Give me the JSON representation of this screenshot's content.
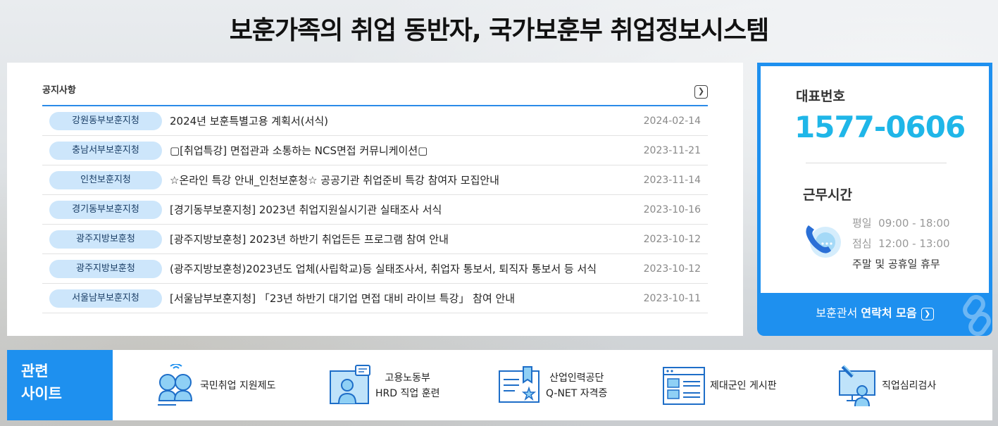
{
  "title": "보훈가족의 취업 동반자, 국가보훈부 취업정보시스템",
  "notice": {
    "heading": "공지사항",
    "more_icon": "chevron-right-icon",
    "items": [
      {
        "org": "강원동부보훈지청",
        "title": "2024년 보훈특별고용 계획서(서식)",
        "date": "2024-02-14"
      },
      {
        "org": "충남서부보훈지청",
        "title": "▢[취업특강] 면접관과 소통하는 NCS면접 커뮤니케이션▢",
        "date": "2023-11-21"
      },
      {
        "org": "인천보훈지청",
        "title": "☆온라인 특강 안내_인천보훈청☆ 공공기관 취업준비 특강 참여자 모집안내",
        "date": "2023-11-14"
      },
      {
        "org": "경기동부보훈지청",
        "title": " [경기동부보훈지청] 2023년 취업지원실시기관 실태조사 서식",
        "date": "2023-10-16"
      },
      {
        "org": "광주지방보훈청",
        "title": "[광주지방보훈청] 2023년 하반기 취업든든 프로그램 참여 안내",
        "date": "2023-10-12"
      },
      {
        "org": "광주지방보훈청",
        "title": "(광주지방보훈청)2023년도 업체(사립학교)등 실태조사서, 취업자 통보서, 퇴직자 통보서 등 서식",
        "date": "2023-10-12"
      },
      {
        "org": "서울남부보훈지청",
        "title": "[서울남부보훈지청] 「23년 하반기 대기업 면접 대비 라이브 특강」 참여 안내",
        "date": "2023-10-11"
      }
    ]
  },
  "contact": {
    "rep_label": "대표번호",
    "rep_number": "1577-0606",
    "hours_label": "근무시간",
    "hours": [
      {
        "label": "평일",
        "value": "09:00 - 18:00"
      },
      {
        "label": "점심",
        "value": "12:00 - 13:00"
      },
      {
        "label": "",
        "value": "주말 및 공휴일 휴무"
      }
    ],
    "link_prefix": "보훈관서 ",
    "link_bold": "연락처 모음",
    "accent": "#1e90ef",
    "number_color": "#1fb6e8"
  },
  "related": {
    "label_line1": "관련",
    "label_line2": "사이트",
    "sites": [
      {
        "line1": "국민취업 지원제도",
        "line2": "",
        "icon": "people-icon"
      },
      {
        "line1": "고용노동부",
        "line2": "HRD 직업 훈련",
        "icon": "teacher-icon"
      },
      {
        "line1": "산업인력공단",
        "line2": "Q-NET 자격증",
        "icon": "certificate-icon"
      },
      {
        "line1": "제대군인 게시판",
        "line2": "",
        "icon": "board-icon"
      },
      {
        "line1": "직업심리검사",
        "line2": "",
        "icon": "test-icon"
      }
    ]
  }
}
